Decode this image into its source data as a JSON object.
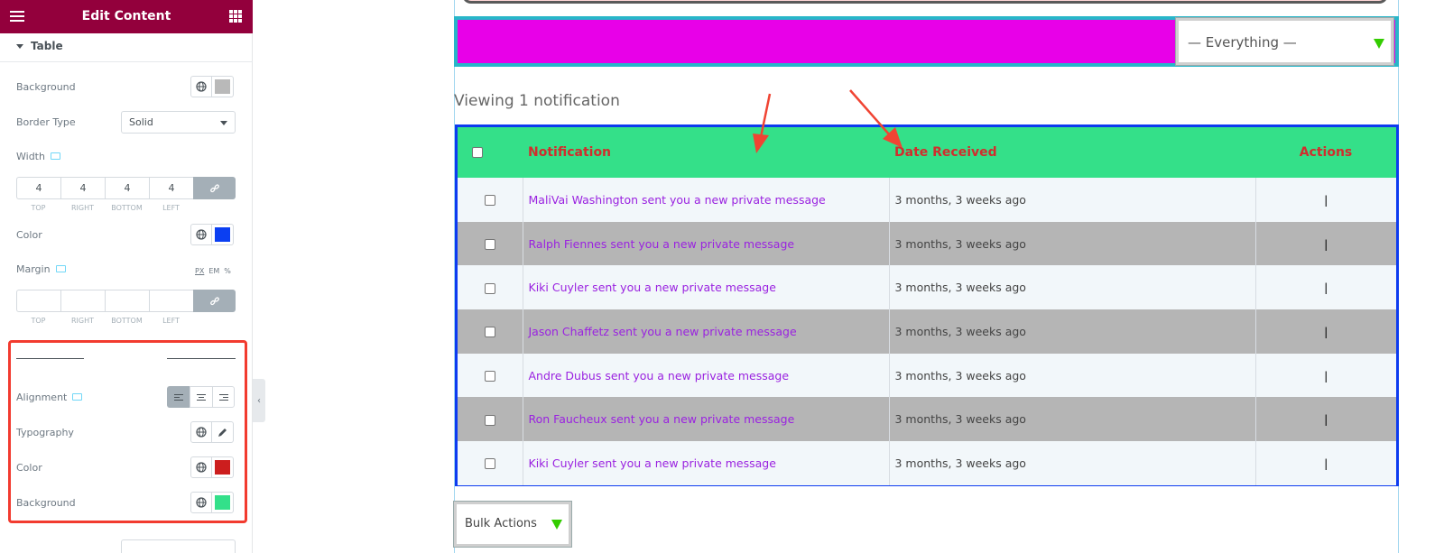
{
  "panel": {
    "title": "Edit Content",
    "section": "Table",
    "labels": {
      "background": "Background",
      "border_type": "Border Type",
      "width": "Width",
      "color": "Color",
      "margin": "Margin",
      "alignment": "Alignment",
      "typography": "Typography",
      "color2": "Color",
      "background2": "Background"
    },
    "border_type_value": "Solid",
    "width_values": [
      "4",
      "4",
      "4",
      "4"
    ],
    "margin_values": [
      "",
      "",
      "",
      ""
    ],
    "dim_labels": [
      "TOP",
      "RIGHT",
      "BOTTOM",
      "LEFT"
    ],
    "units": [
      "PX",
      "EM",
      "%"
    ],
    "swatches": {
      "background": "#b9b9b9",
      "border_color": "#0b3ff2",
      "text_color": "#cc1e1e",
      "bg_color": "#33e08a"
    },
    "collapse_glyph": "‹"
  },
  "preview": {
    "filter_value": "— Everything —",
    "viewing_text": "Viewing 1 notification",
    "headers": [
      "Notification",
      "Date Received",
      "Actions"
    ],
    "rows": [
      {
        "notification": "MaliVai Washington sent you a new private message",
        "date": "3 months, 3 weeks ago",
        "action": "|"
      },
      {
        "notification": "Ralph Fiennes sent you a new private message",
        "date": "3 months, 3 weeks ago",
        "action": "|"
      },
      {
        "notification": "Kiki Cuyler sent you a new private message",
        "date": "3 months, 3 weeks ago",
        "action": "|"
      },
      {
        "notification": "Jason Chaffetz sent you a new private message",
        "date": "3 months, 3 weeks ago",
        "action": "|"
      },
      {
        "notification": "Andre Dubus sent you a new private message",
        "date": "3 months, 3 weeks ago",
        "action": "|"
      },
      {
        "notification": "Ron Faucheux sent you a new private message",
        "date": "3 months, 3 weeks ago",
        "action": "|"
      },
      {
        "notification": "Kiki Cuyler sent you a new private message",
        "date": "3 months, 3 weeks ago",
        "action": "|"
      }
    ],
    "bulk_actions": "Bulk Actions"
  }
}
